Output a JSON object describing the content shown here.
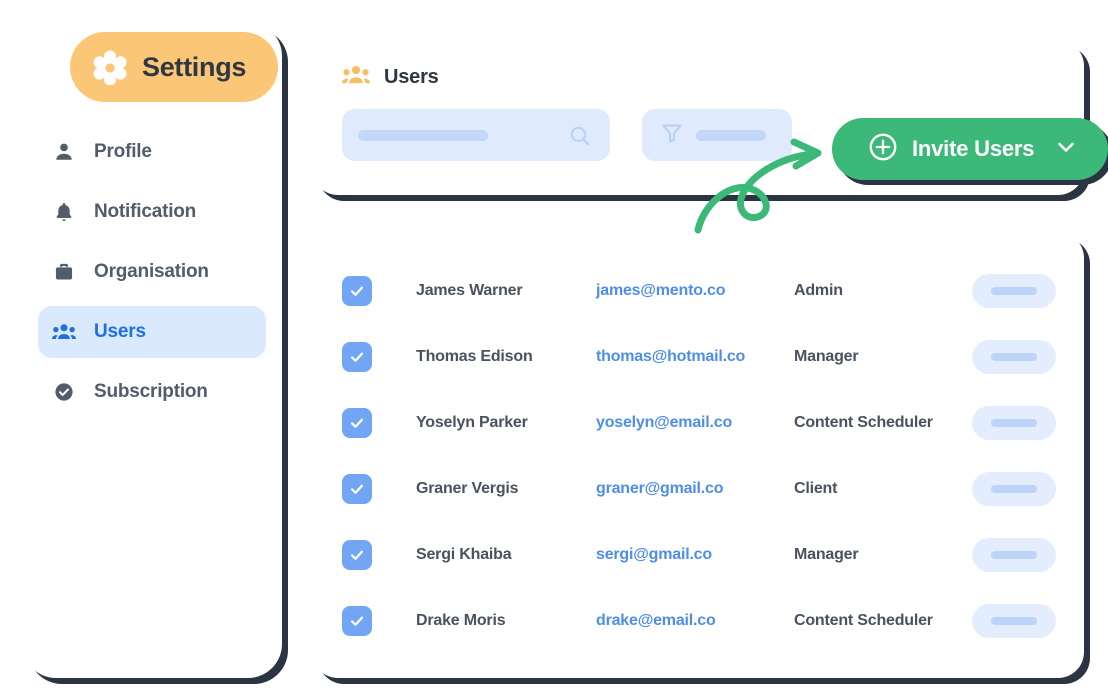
{
  "sidebar": {
    "header": {
      "title": "Settings",
      "icon": "flower-gear-icon",
      "bg": "#fbc777"
    },
    "items": [
      {
        "label": "Profile",
        "icon": "person-icon",
        "active": false
      },
      {
        "label": "Notification",
        "icon": "bell-icon",
        "active": false
      },
      {
        "label": "Organisation",
        "icon": "briefcase-icon",
        "active": false
      },
      {
        "label": "Users",
        "icon": "group-icon",
        "active": true
      },
      {
        "label": "Subscription",
        "icon": "check-circle-icon",
        "active": false
      }
    ]
  },
  "panel": {
    "title": "Users",
    "title_icon": "group-icon",
    "search": {
      "placeholder": "",
      "value": "",
      "icon": "search-icon"
    },
    "filter": {
      "label": "",
      "icon": "funnel-icon"
    },
    "invite_button": {
      "label": "Invite Users",
      "icon": "plus-circle-icon",
      "chevron": "chevron-down-icon",
      "color": "#3cb878"
    }
  },
  "table": {
    "rows": [
      {
        "checked": true,
        "name": "James Warner",
        "email": "james@mento.co",
        "role": "Admin"
      },
      {
        "checked": true,
        "name": "Thomas Edison",
        "email": "thomas@hotmail.co",
        "role": "Manager"
      },
      {
        "checked": true,
        "name": "Yoselyn Parker",
        "email": "yoselyn@email.co",
        "role": "Content Scheduler"
      },
      {
        "checked": true,
        "name": "Graner Vergis",
        "email": "graner@gmail.co",
        "role": "Client"
      },
      {
        "checked": true,
        "name": "Sergi Khaiba",
        "email": "sergi@gmail.co",
        "role": "Manager"
      },
      {
        "checked": true,
        "name": "Drake Moris",
        "email": "drake@email.co",
        "role": "Content Scheduler"
      }
    ]
  },
  "annotation": {
    "arrow": "curved-loop-arrow",
    "color": "#3cb878"
  },
  "colors": {
    "accent_amber": "#fbc777",
    "accent_blue": "#1f6fe5",
    "accent_green": "#3cb878",
    "shadow_navy": "#2b3442",
    "pill_light_blue": "#dfeafd"
  }
}
